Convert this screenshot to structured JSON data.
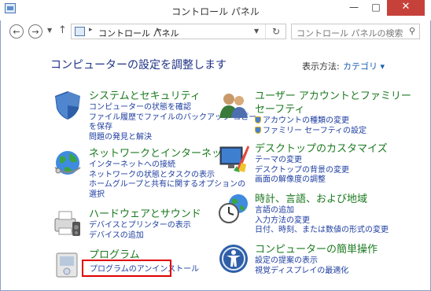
{
  "window": {
    "title": "コントロール パネル",
    "minimize": "—",
    "maximize": "□",
    "close": "✕"
  },
  "address": {
    "path": "コントロール パネル",
    "separator": "▸",
    "search_placeholder": "コントロール パネルの検索"
  },
  "header": {
    "title": "コンピューターの設定を調整します",
    "view_label": "表示方法:",
    "view_value": "カテゴリ ▾"
  },
  "categories": [
    {
      "title": "システムとセキュリティ",
      "links": [
        "コンピューターの状態を確認",
        "ファイル履歴でファイルのバックアップ コピー",
        "を保存",
        "問題の発見と解決"
      ]
    },
    {
      "title": "ネットワークとインターネット",
      "links": [
        "インターネットへの接続",
        "ネットワークの状態とタスクの表示",
        "ホームグループと共有に関するオプションの",
        "選択"
      ]
    },
    {
      "title": "ハードウェアとサウンド",
      "links": [
        "デバイスとプリンターの表示",
        "デバイスの追加"
      ]
    },
    {
      "title": "プログラム",
      "links": [
        "プログラムのアンインストール"
      ]
    },
    {
      "title": "ユーザー アカウントとファミリー",
      "title2": "セーフティ",
      "links": [
        "アカウントの種類の変更",
        "ファミリー セーフティの設定"
      ]
    },
    {
      "title": "デスクトップのカスタマイズ",
      "links": [
        "テーマの変更",
        "デスクトップの背景の変更",
        "画面の解像度の調整"
      ]
    },
    {
      "title": "時計、言語、および地域",
      "links": [
        "言語の追加",
        "入力方法の変更",
        "日付、時刻、または数値の形式の変更"
      ]
    },
    {
      "title": "コンピューターの簡単操作",
      "links": [
        "設定の提案の表示",
        "視覚ディスプレイの最適化"
      ]
    }
  ]
}
